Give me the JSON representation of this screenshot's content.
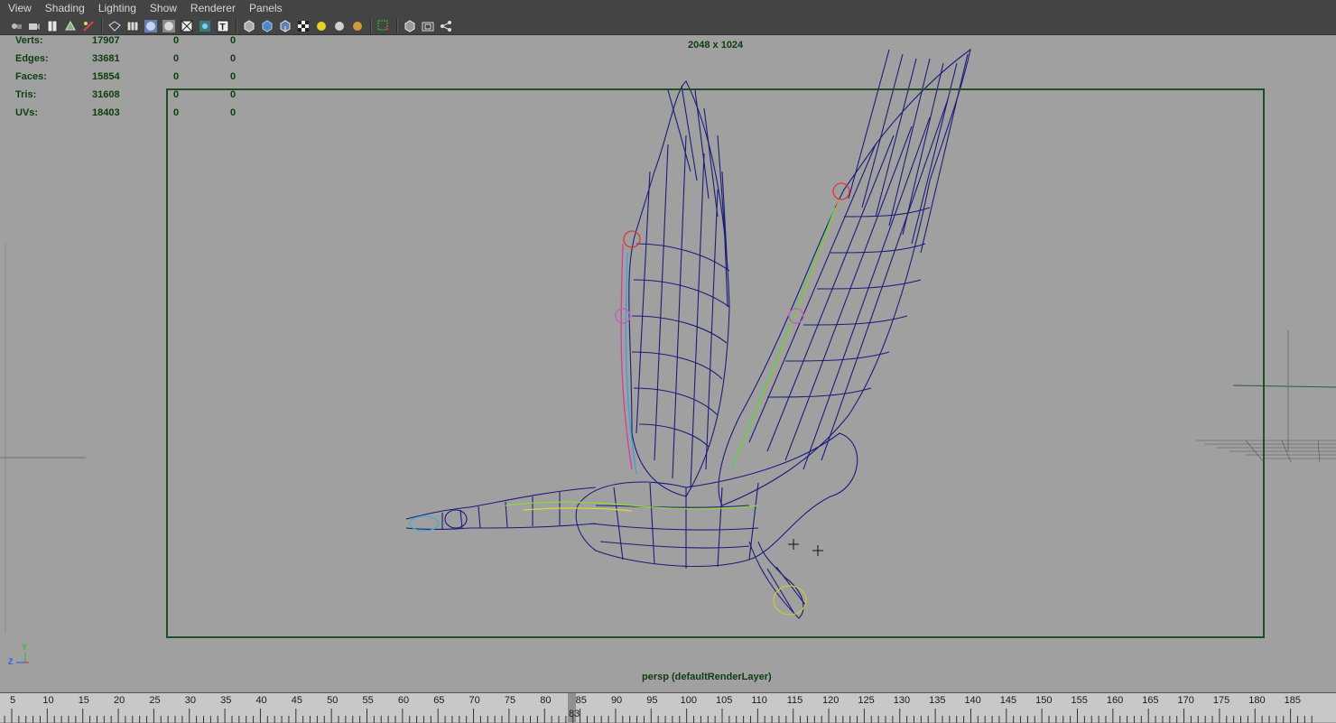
{
  "menu": [
    "View",
    "Shading",
    "Lighting",
    "Show",
    "Renderer",
    "Panels"
  ],
  "toolbar_icons": [
    "select-camera-icon",
    "camera-attributes-icon",
    "bookmark-icon",
    "image-plane-icon",
    "grease-pencil-icon",
    "wireframe-icon",
    "grid-icon",
    "smooth-shade-icon",
    "default-material-icon",
    "xray-icon",
    "isolate-icon",
    "texture-icon",
    "wireframe-cube-icon",
    "shaded-cube-icon",
    "shaded-wire-cube-icon",
    "checker-icon",
    "all-lights-icon",
    "default-light-icon",
    "shadow-light-icon",
    "isolate-select-icon",
    "film-gate-icon",
    "resolution-gate-icon",
    "gate-mask-icon"
  ],
  "hud": {
    "rows": [
      {
        "label": "Verts:",
        "v1": "17907",
        "v2": "0",
        "v3": "0"
      },
      {
        "label": "Edges:",
        "v1": "33681",
        "v2": "0",
        "v3": "0"
      },
      {
        "label": "Faces:",
        "v1": "15854",
        "v2": "0",
        "v3": "0"
      },
      {
        "label": "Tris:",
        "v1": "31608",
        "v2": "0",
        "v3": "0"
      },
      {
        "label": "UVs:",
        "v1": "18403",
        "v2": "0",
        "v3": "0"
      }
    ]
  },
  "resolution": "2048 x 1024",
  "camera_label": "persp (defaultRenderLayer)",
  "axis": {
    "y": "Y",
    "z": "Z"
  },
  "timeline": {
    "labels": [
      "5",
      "10",
      "15",
      "20",
      "25",
      "30",
      "35",
      "40",
      "45",
      "50",
      "55",
      "60",
      "65",
      "70",
      "75",
      "80",
      "85",
      "90",
      "95",
      "100",
      "105",
      "110",
      "115",
      "120",
      "125",
      "130",
      "135",
      "140",
      "145",
      "150",
      "155",
      "160",
      "165",
      "170",
      "175",
      "180",
      "185"
    ],
    "current_frame": "83"
  },
  "colors": {
    "viewport_bg": "#a0a0a0",
    "wireframe": "#1c1c7a",
    "hud_text": "#0e3d0e",
    "menubar_bg": "#444444"
  }
}
